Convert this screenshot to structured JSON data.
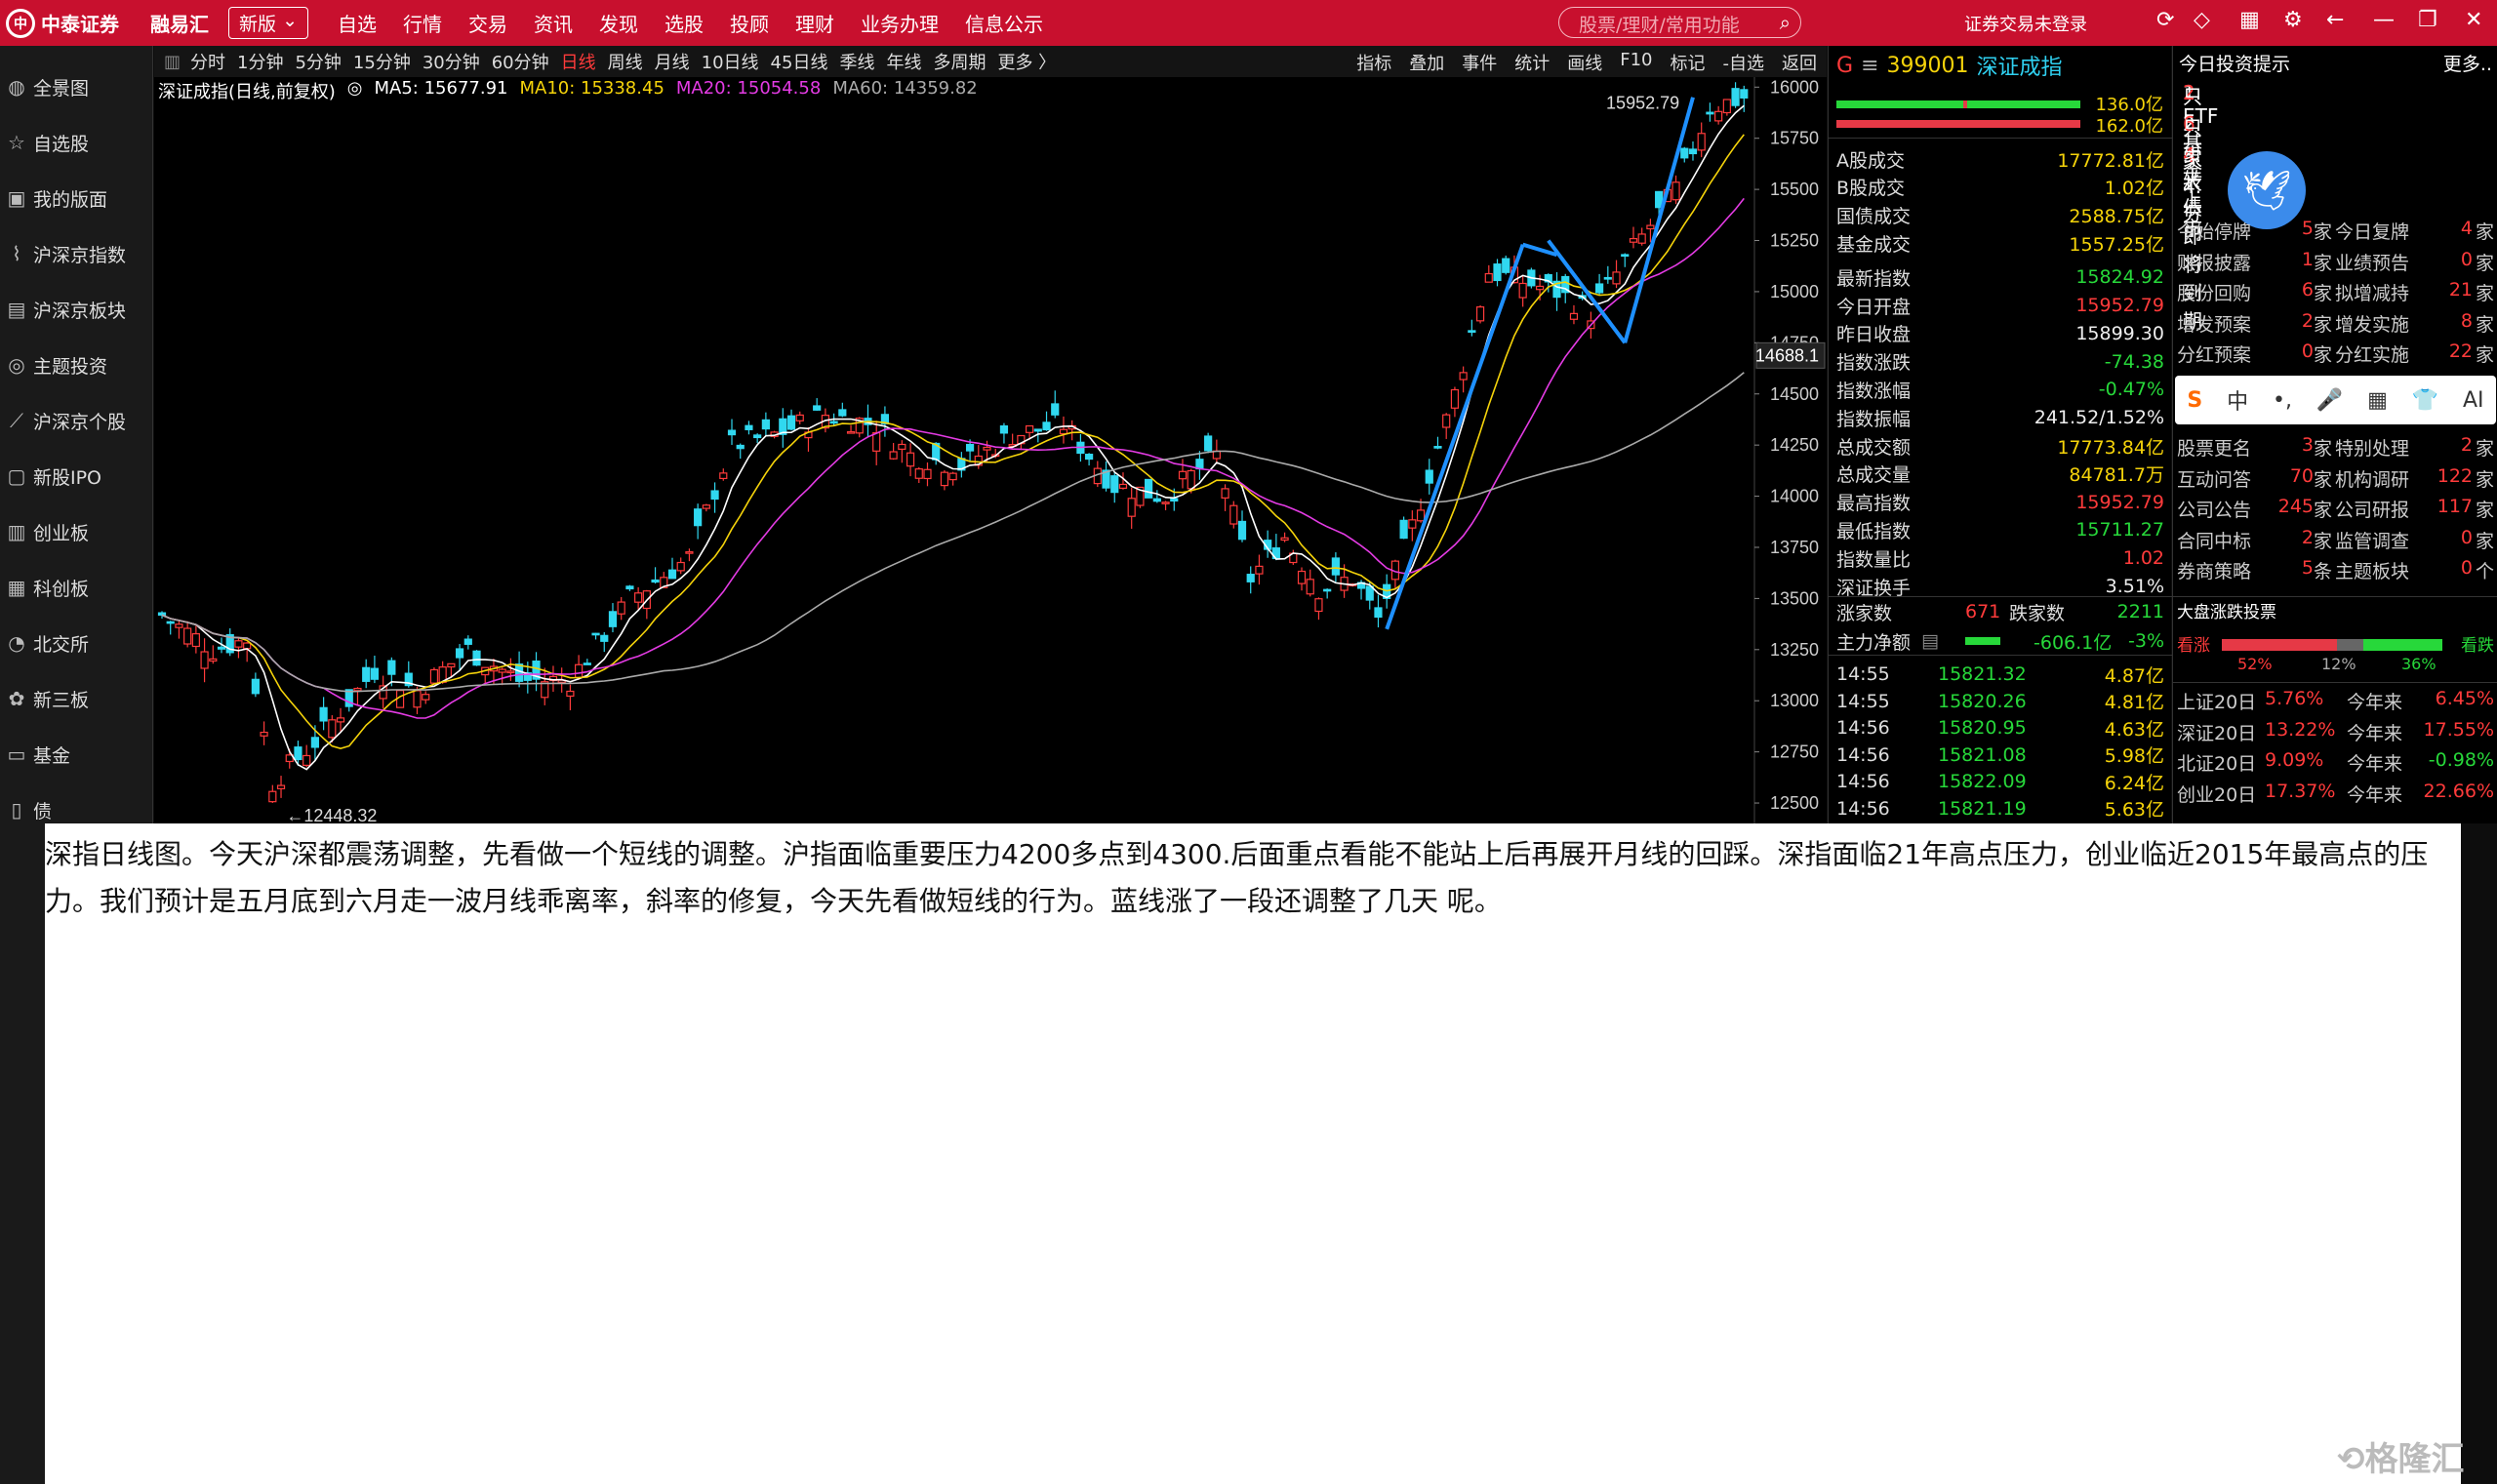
{
  "topbar": {
    "logo_text": "中泰证券",
    "brand": "融易汇",
    "version": "新版",
    "nav": [
      "自选",
      "行情",
      "交易",
      "资讯",
      "发现",
      "选股",
      "投顾",
      "理财",
      "业务办理",
      "信息公示"
    ],
    "search_placeholder": "股票/理财/常用功能",
    "login_status": "证券交易未登录"
  },
  "sidebar": {
    "items": [
      {
        "label": "全景图",
        "icon": "globe-icon"
      },
      {
        "label": "自选股",
        "icon": "star-icon"
      },
      {
        "label": "我的版面",
        "icon": "layout-icon"
      },
      {
        "label": "沪深京指数",
        "icon": "index-chart-icon"
      },
      {
        "label": "沪深京板块",
        "icon": "sector-icon"
      },
      {
        "label": "主题投资",
        "icon": "target-icon"
      },
      {
        "label": "沪深京个股",
        "icon": "stock-chart-icon"
      },
      {
        "label": "新股IPO",
        "icon": "ipo-icon"
      },
      {
        "label": "创业板",
        "icon": "gem-board-icon"
      },
      {
        "label": "科创板",
        "icon": "star-market-icon"
      },
      {
        "label": "北交所",
        "icon": "bse-icon"
      },
      {
        "label": "新三板",
        "icon": "neeq-icon"
      },
      {
        "label": "基金",
        "icon": "fund-icon"
      },
      {
        "label": "债",
        "icon": "bond-icon"
      }
    ]
  },
  "chart_toolbar": {
    "periods": [
      "分时",
      "1分钟",
      "5分钟",
      "15分钟",
      "30分钟",
      "60分钟",
      "日线",
      "周线",
      "月线",
      "10日线",
      "45日线",
      "季线",
      "年线",
      "多周期",
      "更多 〉"
    ],
    "active": "日线",
    "tools": [
      "指标",
      "叠加",
      "事件",
      "统计",
      "画线",
      "F10",
      "标记",
      "-自选",
      "返回"
    ]
  },
  "chart_legend": {
    "name": "深证成指(日线,前复权)",
    "ma5": "MA5: 15677.91",
    "ma10": "MA10: 15338.45",
    "ma20": "MA20: 15054.58",
    "ma60": "MA60: 14359.82"
  },
  "chart_data": {
    "type": "candlestick",
    "y_ticks": [
      16000,
      15750,
      15500,
      15250,
      15000,
      14750,
      14500,
      14250,
      14000,
      13750,
      13500,
      13250,
      13000,
      12750,
      12500
    ],
    "ylim": [
      12400,
      16030
    ],
    "high_label": "15952.79",
    "low_label": "12448.32",
    "cursor_label": "14688.1"
  },
  "quote": {
    "flag": "G",
    "code": "399001",
    "name": "深证成指",
    "bar_top_value": "136.0亿",
    "bar_bottom_value": "162.0亿",
    "rows": [
      {
        "label": "A股成交",
        "value": "17772.81亿",
        "color": "yellow"
      },
      {
        "label": "B股成交",
        "value": "1.02亿",
        "color": "yellow"
      },
      {
        "label": "国债成交",
        "value": "2588.75亿",
        "color": "yellow"
      },
      {
        "label": "基金成交",
        "value": "1557.25亿",
        "color": "yellow"
      },
      {
        "label": "最新指数",
        "value": "15824.92",
        "color": "green"
      },
      {
        "label": "今日开盘",
        "value": "15952.79",
        "color": "red"
      },
      {
        "label": "昨日收盘",
        "value": "15899.30",
        "color": "white"
      },
      {
        "label": "指数涨跌",
        "value": "-74.38",
        "color": "green"
      },
      {
        "label": "指数涨幅",
        "value": "-0.47%",
        "color": "green"
      },
      {
        "label": "指数振幅",
        "value": "241.52/1.52%",
        "color": "white"
      },
      {
        "label": "总成交额",
        "value": "17773.84亿",
        "color": "yellow"
      },
      {
        "label": "总成交量",
        "value": "84781.7万",
        "color": "yellow"
      },
      {
        "label": "最高指数",
        "value": "15952.79",
        "color": "red"
      },
      {
        "label": "最低指数",
        "value": "15711.27",
        "color": "green"
      },
      {
        "label": "指数量比",
        "value": "1.02",
        "color": "red"
      },
      {
        "label": "深证换手",
        "value": "3.51%",
        "color": "white"
      }
    ],
    "rise_label": "涨家数",
    "rise": "671",
    "fall_label": "跌家数",
    "fall": "2211",
    "main_flow_label": "主力净额",
    "main_flow": "-606.1亿",
    "main_flow_pct": "-3%",
    "ticks": [
      {
        "time": "14:55",
        "price": "15821.32",
        "amount": "4.87亿"
      },
      {
        "time": "14:55",
        "price": "15820.26",
        "amount": "4.81亿"
      },
      {
        "time": "14:56",
        "price": "15820.95",
        "amount": "4.63亿"
      },
      {
        "time": "14:56",
        "price": "15821.08",
        "amount": "5.98亿"
      },
      {
        "time": "14:56",
        "price": "15822.09",
        "amount": "6.24亿"
      },
      {
        "time": "14:56",
        "price": "15821.19",
        "amount": "5.63亿"
      }
    ]
  },
  "info_panel": {
    "title": "今日投资提示",
    "more": "更多..",
    "tips": [
      {
        "pre": "1. ETF基金上市",
        "num": "2",
        "post": "只"
      },
      {
        "pre": "2. 可转债即将到期",
        "num": "6",
        "post": "只"
      },
      {
        "pre": "3. 大",
        "num": "4",
        "post": "家"
      },
      {
        "pre": "4. 分",
        "num": "",
        "post": ""
      }
    ],
    "stats": [
      {
        "l": "今始停牌",
        "n": "5",
        "u": "家",
        "l2": "今日复牌",
        "n2": "4",
        "u2": "家"
      },
      {
        "l": "财报披露",
        "n": "1",
        "u": "家",
        "l2": "业绩预告",
        "n2": "0",
        "u2": "家"
      },
      {
        "l": "股份回购",
        "n": "6",
        "u": "家",
        "l2": "拟增减持",
        "n2": "21",
        "u2": "家"
      },
      {
        "l": "增发预案",
        "n": "2",
        "u": "家",
        "l2": "增发实施",
        "n2": "8",
        "u2": "家"
      },
      {
        "l": "分红预案",
        "n": "0",
        "u": "家",
        "l2": "分红实施",
        "n2": "22",
        "u2": "家"
      }
    ],
    "stats2": [
      {
        "l": "股票更名",
        "n": "3",
        "u": "家",
        "l2": "特别处理",
        "n2": "2",
        "u2": "家"
      },
      {
        "l": "互动问答",
        "n": "70",
        "u": "家",
        "l2": "机构调研",
        "n2": "122",
        "u2": "家"
      },
      {
        "l": "公司公告",
        "n": "245",
        "u": "家",
        "l2": "公司研报",
        "n2": "117",
        "u2": "家"
      },
      {
        "l": "合同中标",
        "n": "2",
        "u": "家",
        "l2": "监管调查",
        "n2": "0",
        "u2": "家"
      },
      {
        "l": "券商策略",
        "n": "5",
        "u": "条",
        "l2": "主题板块",
        "n2": "0",
        "u2": "个"
      }
    ],
    "vote_title": "大盘涨跌投票",
    "vote_bull": "看涨",
    "vote_bear": "看跌",
    "vote_pcts": [
      "52%",
      "12%",
      "36%"
    ],
    "vote_split": [
      0.52,
      0.12,
      0.36
    ],
    "perf": [
      {
        "l": "上证20日",
        "v": "5.76%",
        "l2": "今年来",
        "v2": "6.45%",
        "c": "red",
        "c2": "red"
      },
      {
        "l": "深证20日",
        "v": "13.22%",
        "l2": "今年来",
        "v2": "17.55%",
        "c": "red",
        "c2": "red"
      },
      {
        "l": "北证20日",
        "v": "9.09%",
        "l2": "今年来",
        "v2": "-0.98%",
        "c": "red",
        "c2": "green"
      },
      {
        "l": "创业20日",
        "v": "17.37%",
        "l2": "今年来",
        "v2": "22.66%",
        "c": "red",
        "c2": "red"
      }
    ],
    "ime": [
      "S",
      "中",
      "•,",
      "🎤",
      "▦",
      "👕",
      "AI"
    ]
  },
  "comment": {
    "text": "深指日线图。今天沪深都震荡调整，先看做一个短线的调整。沪指面临重要压力4200多点到4300.后面重点看能不能站上后再展开月线的回踩。深指面临21年高点压力，创业临近2015年最高点的压力。我们预计是五月底到六月走一波月线乖离率，斜率的修复，今天先看做短线的行为。蓝线涨了一段还调整了几天 呢。"
  },
  "watermark": "格隆汇"
}
